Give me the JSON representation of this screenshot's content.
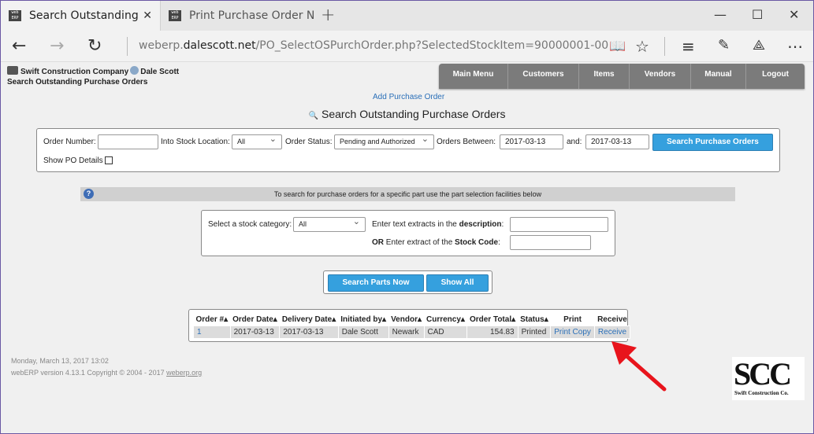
{
  "browser": {
    "tabs": [
      {
        "title": "Search Outstanding Pur",
        "favicon": "web ERP"
      },
      {
        "title": "Print Purchase Order Numb",
        "favicon": "web ERP"
      }
    ],
    "new_tab_icon": "+",
    "window_controls": {
      "minimize": "—",
      "maximize": "☐",
      "close": "✕"
    },
    "url_host": "weberp.dalescott.net",
    "url_path": "/PO_SelectOSPurchOrder.php?SelectedStockItem=90000001-00",
    "url_prefix": "weberp.",
    "url_domain": "dalescott.net"
  },
  "header": {
    "company": "Swift Construction Company",
    "user": "Dale Scott",
    "page_subtitle": "Search Outstanding Purchase Orders"
  },
  "menu": [
    {
      "label": "Main Menu"
    },
    {
      "label": "Customers"
    },
    {
      "label": "Items"
    },
    {
      "label": "Vendors"
    },
    {
      "label": "Manual"
    },
    {
      "label": "Logout"
    }
  ],
  "add_po_link": "Add Purchase Order",
  "main_title": "Search Outstanding Purchase Orders",
  "search_form": {
    "order_number_label": "Order Number:",
    "order_number_value": "",
    "stock_location_label": "Into Stock Location:",
    "stock_location_value": "All",
    "order_status_label": "Order Status:",
    "order_status_value": "Pending and Authorized",
    "orders_between_label": "Orders Between:",
    "date_from": "2017-03-13",
    "and_label": "and:",
    "date_to": "2017-03-13",
    "search_button": "Search Purchase Orders",
    "show_po_details_label": "Show PO Details"
  },
  "info_message": "To search for purchase orders for a specific part use the part selection facilities below",
  "part_form": {
    "category_label": "Select a stock category:",
    "category_value": "All",
    "desc_label_prefix": "Enter text extracts in the ",
    "desc_label_bold": "description",
    "desc_label_suffix": ":",
    "code_label_or": "OR",
    "code_label_mid": " Enter extract of the ",
    "code_label_bold": "Stock Code",
    "code_label_suffix": ":",
    "search_parts_button": "Search Parts Now",
    "show_all_button": "Show All"
  },
  "results": {
    "headers": [
      "Order #",
      "Order Date",
      "Delivery Date",
      "Initiated by",
      "Vendor",
      "Currency",
      "Order Total",
      "Status",
      "Print",
      "Receive"
    ],
    "sortable": [
      true,
      true,
      true,
      true,
      true,
      true,
      true,
      true,
      false,
      false
    ],
    "rows": [
      {
        "order": "1",
        "order_date": "2017-03-13",
        "delivery_date": "2017-03-13",
        "initiated_by": "Dale Scott",
        "vendor": "Newark",
        "currency": "CAD",
        "total": "154.83",
        "status": "Printed",
        "print": "Print Copy",
        "receive": "Receive"
      }
    ]
  },
  "footer": {
    "date": "Monday, March 13, 2017 13:02",
    "version": "webERP version 4.13.1 Copyright © 2004 - 2017 ",
    "version_link": "weberp.org"
  },
  "logo": {
    "big": "SCC",
    "small": "Swift Construction Co."
  },
  "annotation": {
    "arrow_color": "#e8141c"
  }
}
